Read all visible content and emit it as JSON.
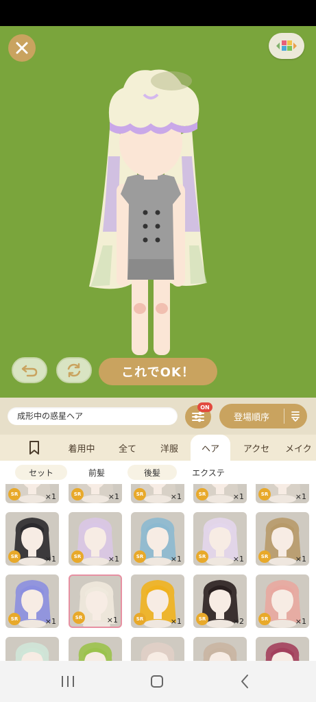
{
  "stage": {
    "background": "#7aa53c",
    "ok_label": "これでOK！"
  },
  "controls": {
    "search_value": "成形中の惑星ヘア",
    "filter_badge": "ON",
    "sort_label": "登場順序"
  },
  "category_tabs": [
    {
      "label": "",
      "icon": "bookmark-icon"
    },
    {
      "label": "着用中"
    },
    {
      "label": "全て"
    },
    {
      "label": "洋服"
    },
    {
      "label": "ヘア",
      "active": true
    },
    {
      "label": "アクセ"
    },
    {
      "label": "メイク"
    }
  ],
  "sub_tabs": [
    {
      "label": "セット",
      "active": true
    },
    {
      "label": "前髪"
    },
    {
      "label": "後髪",
      "active": true
    },
    {
      "label": "エクステ"
    }
  ],
  "grid": {
    "rarity": "SR",
    "row1_counts": [
      "×1",
      "×1",
      "×1",
      "×1",
      "×1"
    ],
    "row2": [
      {
        "count": "×1",
        "hair": "#2b2a2e"
      },
      {
        "count": "×1",
        "hair": "#d9c7e6"
      },
      {
        "count": "×1",
        "hair": "#8cb9d0"
      },
      {
        "count": "×1",
        "hair": "#e3d6ec"
      },
      {
        "count": "×1",
        "hair": "#b79a6a"
      }
    ],
    "row3": [
      {
        "count": "×1",
        "hair": "#8b8fe0"
      },
      {
        "count": "×1",
        "hair": "#efe9dd",
        "selected": true
      },
      {
        "count": "×1",
        "hair": "#f0b21f"
      },
      {
        "count": "×2",
        "hair": "#2a2020"
      },
      {
        "count": "×1",
        "hair": "#e8a8a0"
      }
    ],
    "row4": [
      {
        "hair": "#cfe6d8"
      },
      {
        "hair": "#9bc24d"
      },
      {
        "hair": "#e0cfc6"
      },
      {
        "hair": "#c9b5a2"
      },
      {
        "hair": "#a3405c"
      }
    ]
  },
  "colors": {
    "accent": "#c9a35f",
    "badge": "#e24a3e",
    "rarity": "#e8a92a",
    "selected_border": "#e790a2"
  }
}
